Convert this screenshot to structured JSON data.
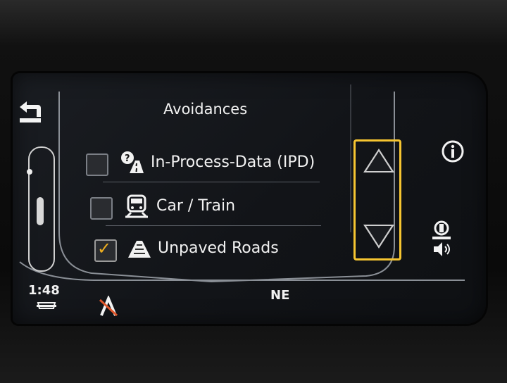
{
  "screen": {
    "title": "Avoidances",
    "rows": [
      {
        "label": "In-Process-Data (IPD)",
        "checked": false,
        "icon": "road-question-icon"
      },
      {
        "label": "Car / Train",
        "checked": false,
        "icon": "train-icon"
      },
      {
        "label": "Unpaved Roads",
        "checked": true,
        "icon": "unpaved-road-icon"
      }
    ],
    "check_symbol": "✓"
  },
  "status": {
    "time": "1:48",
    "heading": "NE"
  },
  "colors": {
    "highlight": "#f6c531",
    "checkmark": "#f0b020",
    "text": "#f2f2f2"
  }
}
